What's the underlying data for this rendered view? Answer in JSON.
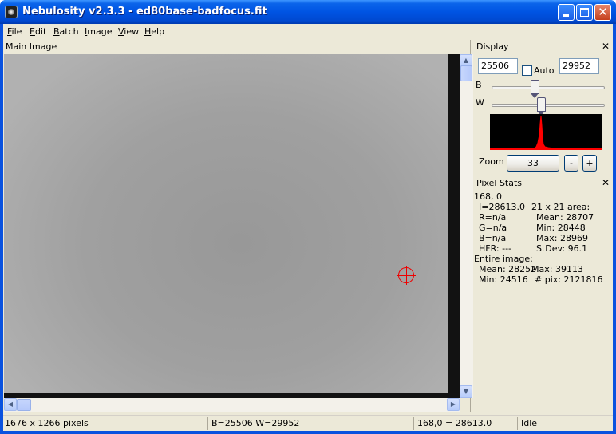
{
  "window": {
    "title": "Nebulosity v2.3.3 - ed80base-badfocus.fit",
    "minimize_icon": "minimize-icon",
    "maximize_icon": "maximize-icon",
    "close_icon": "close-icon",
    "close_glyph": "✕"
  },
  "menu": {
    "items": [
      "File",
      "Edit",
      "Batch",
      "Image",
      "View",
      "Help"
    ]
  },
  "main_image": {
    "caption": "Main Image",
    "scroll_up_glyph": "▲",
    "scroll_down_glyph": "▼",
    "scroll_left_glyph": "◀",
    "scroll_right_glyph": "▶"
  },
  "display": {
    "title": "Display",
    "close_glyph": "✕",
    "black_value": "25506",
    "white_value": "29952",
    "auto_label": "Auto",
    "auto_checked": false,
    "b_label": "B",
    "w_label": "W",
    "b_slider_level": 0.38,
    "w_slider_level": 0.44,
    "zoom_label": "Zoom",
    "zoom_value": "33",
    "zoom_minus": "-",
    "zoom_plus": "+"
  },
  "pixel_stats": {
    "title": "Pixel Stats",
    "close_glyph": "✕",
    "coords": "168, 0",
    "i_value": "I=28613.0",
    "r_value": "R=n/a",
    "g_value": "G=n/a",
    "b_value": "B=n/a",
    "hfr_value": "HFR: ---",
    "area_label": "21 x 21 area:",
    "area_mean": "Mean: 28707",
    "area_min": "Min: 28448",
    "area_max": "Max: 28969",
    "area_stdev": "StDev: 96.1",
    "entire_label": "Entire image:",
    "entire_mean": "Mean: 28252",
    "entire_max": "Max: 39113",
    "entire_min": "Min: 24516",
    "entire_npix": "# pix: 2121816"
  },
  "status": {
    "dimensions": "1676 x 1266 pixels",
    "bw": "B=25506 W=29952",
    "pixel": "168,0 = 28613.0",
    "state": "Idle"
  },
  "colors": {
    "title_bar": "#0054e3",
    "histogram_bg": "#000000",
    "histogram_fg": "#ff0000",
    "crosshair": "#ee0000"
  }
}
